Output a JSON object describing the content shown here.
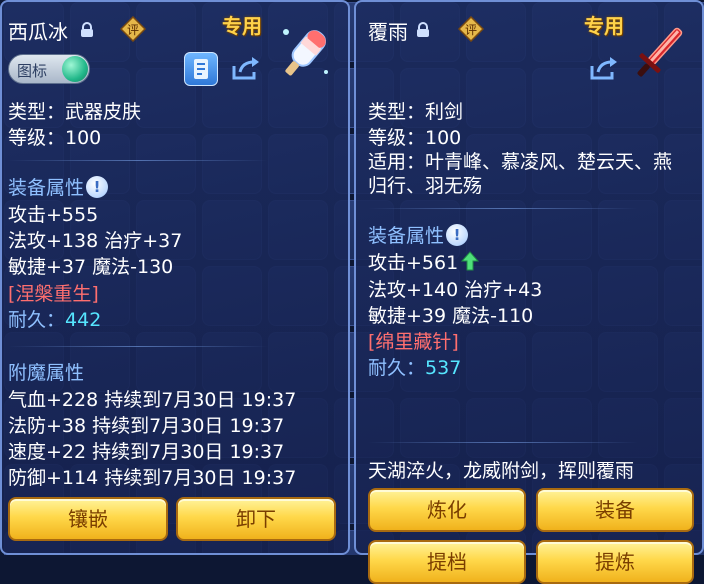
{
  "left": {
    "name": "西瓜冰",
    "rate_badge": "评",
    "exclusive": "专用",
    "toggle_label": "图标",
    "icons": {
      "lock": "lock-icon",
      "info": "info-icon",
      "share": "share-icon",
      "item": "popsicle-icon"
    },
    "type": "类型：武器皮肤",
    "level": "等级：100",
    "attr_title": "装备属性",
    "help": "!",
    "stats": [
      "攻击+555",
      "法攻+138 治疗+37",
      "敏捷+37 魔法-130"
    ],
    "special": "[涅槃重生]",
    "durability_label": "耐久：",
    "durability_value": "442",
    "enchant_title": "附魔属性",
    "enchants": [
      "气血+228 持续到7月30日 19:37",
      "法防+38 持续到7月30日 19:37",
      "速度+22 持续到7月30日 19:37",
      "防御+114 持续到7月30日 19:37"
    ],
    "buttons": [
      "镶嵌",
      "卸下"
    ]
  },
  "right": {
    "name": "覆雨",
    "rate_badge": "评",
    "exclusive": "专用",
    "icons": {
      "lock": "lock-icon",
      "share": "share-icon",
      "item": "red-sword-icon",
      "up": "up-arrow-icon"
    },
    "type": "类型：利剑",
    "level": "等级：100",
    "applicable_1": "适用：叶青峰、慕凌风、楚云天、燕",
    "applicable_2": "归行、羽无殇",
    "attr_title": "装备属性",
    "help": "!",
    "stats": [
      "攻击+561",
      "法攻+140 治疗+43",
      "敏捷+39 魔法-110"
    ],
    "special": "[绵里藏针]",
    "durability_label": "耐久：",
    "durability_value": "537",
    "description": "天湖淬火，龙威附剑，挥则覆雨",
    "buttons": [
      "炼化",
      "装备",
      "提档",
      "提炼"
    ]
  },
  "colors": {
    "gold": "#ffd24a",
    "section": "#8fc0ff",
    "special": "#ff6f6f",
    "durability": "#56e6ff"
  }
}
